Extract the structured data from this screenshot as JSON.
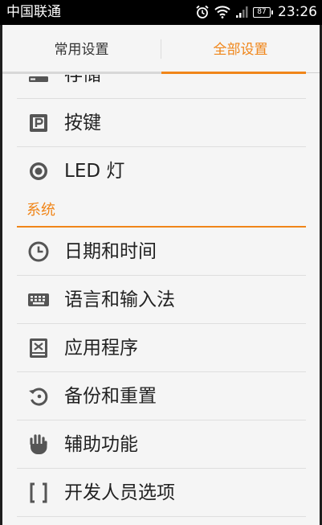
{
  "status_bar": {
    "carrier": "中国联通",
    "battery": "87",
    "time": "23:26"
  },
  "tabs": [
    {
      "label": "常用设置",
      "selected": false
    },
    {
      "label": "全部设置",
      "selected": true
    }
  ],
  "colors": {
    "accent": "#f08519",
    "text": "#222222",
    "icon": "#555555"
  },
  "items_top": [
    {
      "label": "存储",
      "icon": "storage-icon"
    },
    {
      "label": "按键",
      "icon": "key-icon"
    },
    {
      "label": "LED 灯",
      "icon": "led-icon"
    }
  ],
  "section": {
    "title": "系统"
  },
  "items_system": [
    {
      "label": "日期和时间",
      "icon": "clock-icon"
    },
    {
      "label": "语言和输入法",
      "icon": "keyboard-icon"
    },
    {
      "label": "应用程序",
      "icon": "apps-icon"
    },
    {
      "label": "备份和重置",
      "icon": "backup-icon"
    },
    {
      "label": "辅助功能",
      "icon": "hand-icon"
    },
    {
      "label": "开发人员选项",
      "icon": "brackets-icon"
    }
  ]
}
